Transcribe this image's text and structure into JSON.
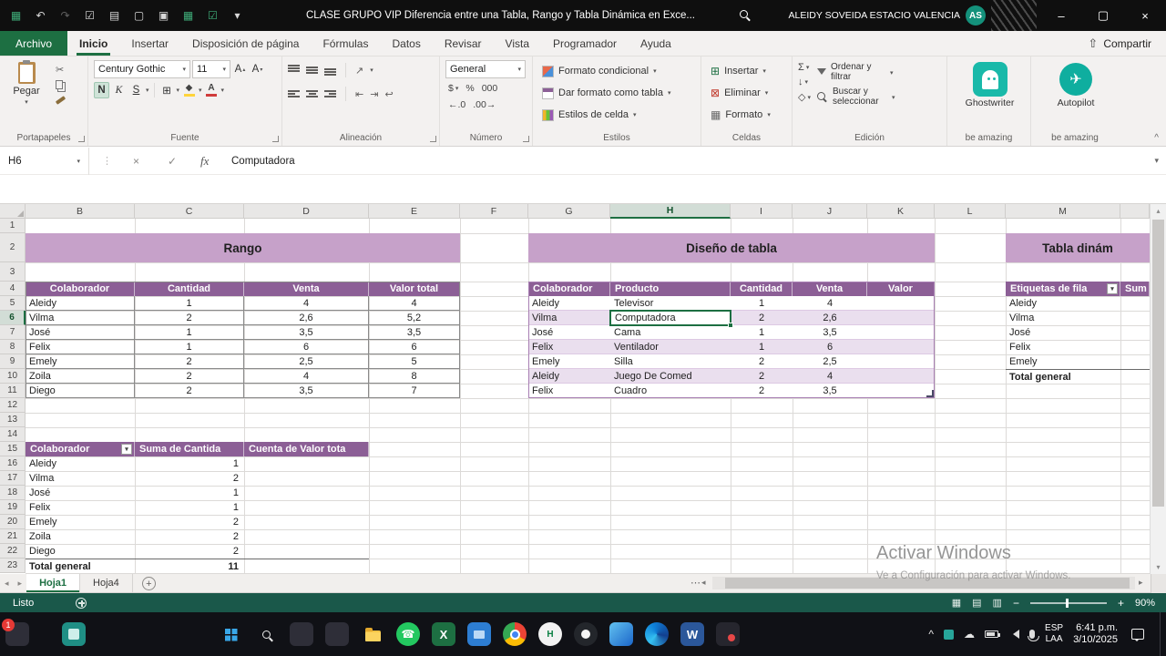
{
  "titlebar": {
    "title": "CLASE GRUPO VIP Diferencia entre una Tabla, Rango y Tabla Dinámica en Exce...",
    "user": "ALEIDY SOVEIDA ESTACIO VALENCIA",
    "avatar_initials": "AS",
    "qat_icons": [
      {
        "name": "excel-logo-icon",
        "glyph": "▦",
        "cls": "green"
      },
      {
        "name": "undo-icon",
        "glyph": "↶",
        "cls": ""
      },
      {
        "name": "redo-icon",
        "glyph": "↷",
        "cls": "dim"
      },
      {
        "name": "checklist-icon",
        "glyph": "☑",
        "cls": ""
      },
      {
        "name": "list-icon",
        "glyph": "▤",
        "cls": ""
      },
      {
        "name": "window-icon",
        "glyph": "▢",
        "cls": ""
      },
      {
        "name": "camera-icon",
        "glyph": "▣",
        "cls": ""
      },
      {
        "name": "table-icon",
        "glyph": "▦",
        "cls": "green"
      },
      {
        "name": "checkbox-icon",
        "glyph": "☑",
        "cls": "green"
      },
      {
        "name": "more-commands-icon",
        "glyph": "▾",
        "cls": ""
      }
    ],
    "window_controls": {
      "minimize": "–",
      "maximize": "▢",
      "close": "×"
    }
  },
  "ribbon_tabs": [
    {
      "label": "Archivo",
      "style": "file"
    },
    {
      "label": "Inicio",
      "style": "active"
    },
    {
      "label": "Insertar"
    },
    {
      "label": "Disposición de página"
    },
    {
      "label": "Fórmulas"
    },
    {
      "label": "Datos"
    },
    {
      "label": "Revisar"
    },
    {
      "label": "Vista"
    },
    {
      "label": "Programador"
    },
    {
      "label": "Ayuda"
    }
  ],
  "share_label": "Compartir",
  "ribbon": {
    "paste_label": "Pegar",
    "font_name": "Century Gothic",
    "font_size": "11",
    "bold_label": "N",
    "italic_label": "K",
    "underline_label": "S",
    "number_format": "General",
    "currency": "$",
    "percent": "%",
    "thousands": "000",
    "dec_inc": "←.0",
    "dec_dec": ".00→",
    "conditional_label": "Formato condicional",
    "format_table_label": "Dar formato como tabla",
    "cell_styles_label": "Estilos de celda",
    "insert_label": "Insertar",
    "delete_label": "Eliminar",
    "format_label": "Formato",
    "autosum": "Σ",
    "sort_label": "Ordenar y filtrar",
    "find_label": "Buscar y seleccionar",
    "ghostwriter_label": "Ghostwriter",
    "autopilot_label": "Autopilot",
    "group_labels": [
      "Portapapeles",
      "Fuente",
      "Alineación",
      "Número",
      "Estilos",
      "Celdas",
      "Edición",
      "be amazing",
      "be amazing"
    ]
  },
  "formula_bar": {
    "name_box": "H6",
    "fx": "fx",
    "content": "Computadora"
  },
  "grid": {
    "column_headers": [
      "B",
      "C",
      "D",
      "E",
      "F",
      "G",
      "H",
      "I",
      "J",
      "K",
      "L",
      "M"
    ],
    "row_headers": [
      "1",
      "2",
      "3",
      "4",
      "5",
      "6",
      "7",
      "8",
      "9",
      "10",
      "11",
      "12",
      "13",
      "14",
      "15",
      "16",
      "17",
      "18",
      "19",
      "20",
      "21",
      "22",
      "23"
    ],
    "selected_cell": "H6",
    "selected_column": "H",
    "selected_row": "6"
  },
  "rango": {
    "title": "Rango",
    "headers": [
      "Colaborador",
      "Cantidad",
      "Venta",
      "Valor total"
    ],
    "rows": [
      [
        "Aleidy",
        "1",
        "4",
        "4"
      ],
      [
        "Vilma",
        "2",
        "2,6",
        "5,2"
      ],
      [
        "José",
        "1",
        "3,5",
        "3,5"
      ],
      [
        "Felix",
        "1",
        "6",
        "6"
      ],
      [
        "Emely",
        "2",
        "2,5",
        "5"
      ],
      [
        "Zoila",
        "2",
        "4",
        "8"
      ],
      [
        "Diego",
        "2",
        "3,5",
        "7"
      ]
    ]
  },
  "tabla": {
    "title": "Diseño de tabla",
    "headers": [
      "Colaborador",
      "Producto",
      "Cantidad",
      "Venta",
      "Valor"
    ],
    "rows": [
      [
        "Aleidy",
        "Televisor",
        "1",
        "4",
        ""
      ],
      [
        "Vilma",
        "Computadora",
        "2",
        "2,6",
        ""
      ],
      [
        "José",
        "Cama",
        "1",
        "3,5",
        ""
      ],
      [
        "Felix",
        "Ventilador",
        "1",
        "6",
        ""
      ],
      [
        "Emely",
        "Silla",
        "2",
        "2,5",
        ""
      ],
      [
        "Aleidy",
        "Juego De Comed",
        "2",
        "4",
        ""
      ],
      [
        "Felix",
        "Cuadro",
        "2",
        "3,5",
        ""
      ]
    ]
  },
  "dinamica": {
    "title": "Tabla dinám",
    "row_header_label": "Etiquetas de fila",
    "value_header_label": "Sum",
    "rows": [
      "Aleidy",
      "Vilma",
      "José",
      "Felix",
      "Emely"
    ],
    "total_label": "Total general"
  },
  "pivot": {
    "headers": [
      "Colaborador",
      "Suma de Cantida",
      "Cuenta de Valor tota"
    ],
    "rows": [
      [
        "Aleidy",
        "1"
      ],
      [
        "Vilma",
        "2"
      ],
      [
        "José",
        "1"
      ],
      [
        "Felix",
        "1"
      ],
      [
        "Emely",
        "2"
      ],
      [
        "Zoila",
        "2"
      ],
      [
        "Diego",
        "2"
      ]
    ],
    "total_label": "Total general",
    "total_value": "11"
  },
  "sheet_bar": {
    "tabs": [
      {
        "label": "Hoja1",
        "active": true
      },
      {
        "label": "Hoja4",
        "active": false
      }
    ]
  },
  "status_bar": {
    "status": "Listo",
    "zoom": "90%"
  },
  "watermark": {
    "line1": "Activar Windows",
    "line2": "Ve a Configuración para activar Windows."
  },
  "taskbar": {
    "badge": "1",
    "center_icons": [
      {
        "name": "start-icon",
        "style": "start"
      },
      {
        "name": "search-icon",
        "style": "magw"
      },
      {
        "name": "app-icon-1",
        "style": "dark"
      },
      {
        "name": "app-icon-2",
        "style": "dark"
      },
      {
        "name": "file-explorer-icon",
        "style": "folder"
      },
      {
        "name": "whatsapp-icon",
        "style": "whatsapp",
        "glyph": "☎"
      },
      {
        "name": "excel-icon",
        "style": "excel",
        "glyph": "X"
      },
      {
        "name": "monitor-app-icon",
        "style": "blue"
      },
      {
        "name": "chrome-icon",
        "style": "chrome"
      },
      {
        "name": "browser-profile-icon",
        "style": "ring",
        "glyph": "H"
      },
      {
        "name": "dark-circle-app-icon",
        "style": "darkcircle"
      },
      {
        "name": "store-app-icon",
        "style": "tile"
      },
      {
        "name": "edge-icon",
        "style": "edge"
      },
      {
        "name": "word-icon",
        "style": "word",
        "glyph": "W"
      },
      {
        "name": "app-icon-3",
        "style": "reddot"
      }
    ],
    "lang_line1": "ESP",
    "lang_line2": "LAA",
    "time": "6:41 p.m.",
    "date": "3/10/2025"
  },
  "colors": {
    "excel_green": "#1d6f42",
    "header_purple": "#8c5f96",
    "title_purple": "#c6a1c9",
    "band_purple": "#eadfee",
    "status_green": "#1a584a",
    "selection_green": "#1d6f42"
  }
}
